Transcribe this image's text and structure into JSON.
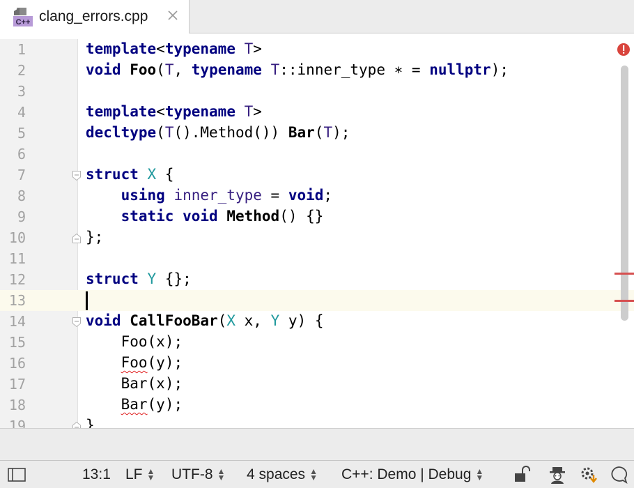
{
  "tab": {
    "icon_text": "C++",
    "filename": "clang_errors.cpp"
  },
  "editor": {
    "lines": [
      {
        "n": "1"
      },
      {
        "n": "2"
      },
      {
        "n": "3"
      },
      {
        "n": "4"
      },
      {
        "n": "5"
      },
      {
        "n": "6"
      },
      {
        "n": "7"
      },
      {
        "n": "8"
      },
      {
        "n": "9"
      },
      {
        "n": "10"
      },
      {
        "n": "11"
      },
      {
        "n": "12"
      },
      {
        "n": "13"
      },
      {
        "n": "14"
      },
      {
        "n": "15"
      },
      {
        "n": "16"
      },
      {
        "n": "17"
      },
      {
        "n": "18"
      },
      {
        "n": "19"
      }
    ],
    "tok": {
      "template": "template",
      "typename": "typename",
      "T": "T",
      "void": "void",
      "Foo": "Foo",
      "inner_type_qual": "::inner_type",
      "nullptr": "nullptr",
      "decltype": "decltype",
      "Method_call": ".Method())",
      "Bar": "Bar",
      "struct": "struct",
      "X": "X",
      "Y": "Y",
      "using": "using",
      "inner_type": "inner_type",
      "static": "static",
      "Method": "Method",
      "CallFooBar": "CallFooBar",
      "x": "x",
      "y": "y"
    },
    "current_line": "13",
    "errors_indicator": "error-icon"
  },
  "status": {
    "position": "13:1",
    "line_sep": "LF",
    "encoding": "UTF-8",
    "indent": "4 spaces",
    "context": "C++: Demo | Debug"
  },
  "colors": {
    "keyword": "#000080",
    "type": "#20999d",
    "template_param": "#371f80",
    "error": "#d65050",
    "current_line": "#fcfaed"
  }
}
